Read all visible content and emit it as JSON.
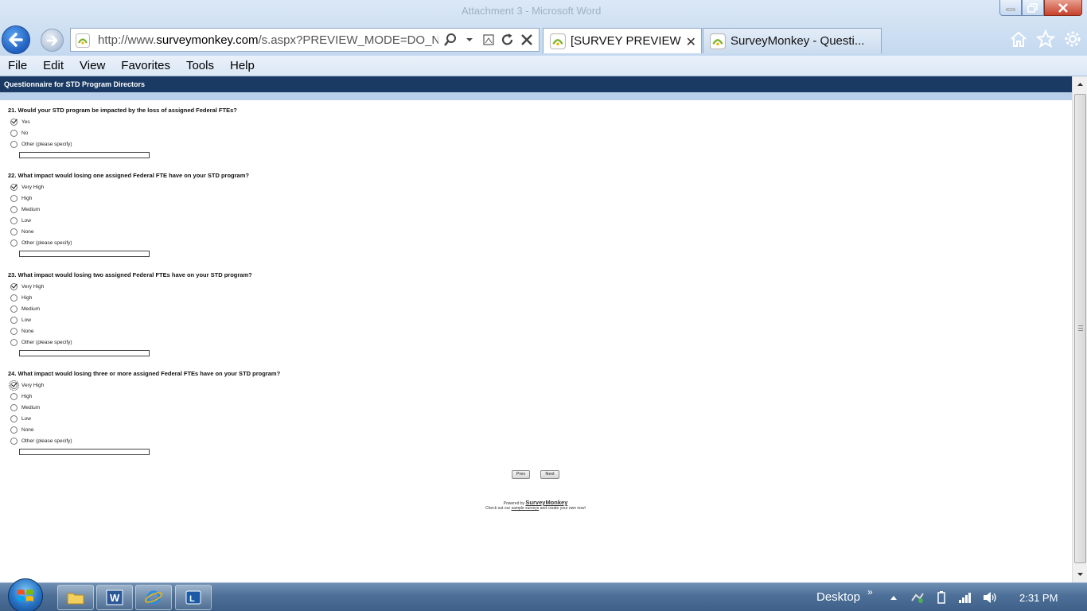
{
  "window": {
    "ghost_title": "Attachment 3 - Microsoft Word"
  },
  "address_bar": {
    "url_prefix": "http://www.",
    "url_domain": "surveymonkey.com",
    "url_rest": "/s.aspx?PREVIEW_MODE=DO_NOT"
  },
  "tabs": [
    {
      "label": "[SURVEY PREVIEW ...",
      "active": true
    },
    {
      "label": "SurveyMonkey - Questi...",
      "active": false
    }
  ],
  "menu": [
    "File",
    "Edit",
    "View",
    "Favorites",
    "Tools",
    "Help"
  ],
  "survey": {
    "header": "Questionnaire for STD Program Directors",
    "questions": [
      {
        "title": "21. Would your STD program be impacted by the loss of assigned Federal FTEs?",
        "options": [
          {
            "label": "Yes",
            "checked": true
          },
          {
            "label": "No",
            "checked": false
          },
          {
            "label": "Other (please specify)",
            "checked": false
          }
        ],
        "other_value": ""
      },
      {
        "title": "22. What impact would losing one assigned Federal FTE have on your STD program?",
        "options": [
          {
            "label": "Very High",
            "checked": true
          },
          {
            "label": "High",
            "checked": false
          },
          {
            "label": "Medium",
            "checked": false
          },
          {
            "label": "Low",
            "checked": false
          },
          {
            "label": "None",
            "checked": false
          },
          {
            "label": "Other (please specify)",
            "checked": false
          }
        ],
        "other_value": ""
      },
      {
        "title": "23. What impact would losing two assigned Federal FTEs have on your STD program?",
        "options": [
          {
            "label": "Very High",
            "checked": true
          },
          {
            "label": "High",
            "checked": false
          },
          {
            "label": "Medium",
            "checked": false
          },
          {
            "label": "Low",
            "checked": false
          },
          {
            "label": "None",
            "checked": false
          },
          {
            "label": "Other (please specify)",
            "checked": false
          }
        ],
        "other_value": ""
      },
      {
        "title": "24. What impact would losing three or more assigned Federal FTEs have on your STD program?",
        "options": [
          {
            "label": "Very High",
            "checked": true,
            "focused": true
          },
          {
            "label": "High",
            "checked": false
          },
          {
            "label": "Medium",
            "checked": false
          },
          {
            "label": "Low",
            "checked": false
          },
          {
            "label": "None",
            "checked": false
          },
          {
            "label": "Other (please specify)",
            "checked": false
          }
        ],
        "other_value": ""
      }
    ],
    "prev_label": "Prev",
    "next_label": "Next",
    "powered_by": "Powered by",
    "brand": "SurveyMonkey",
    "footer_pre": "Check out our",
    "footer_link": "sample surveys",
    "footer_post": "and create your own now!"
  },
  "taskbar": {
    "desktop_label": "Desktop",
    "chevron": "»",
    "clock": "2:31 PM",
    "apps": [
      "windows-explorer",
      "microsoft-word",
      "internet-explorer",
      "lync"
    ]
  }
}
